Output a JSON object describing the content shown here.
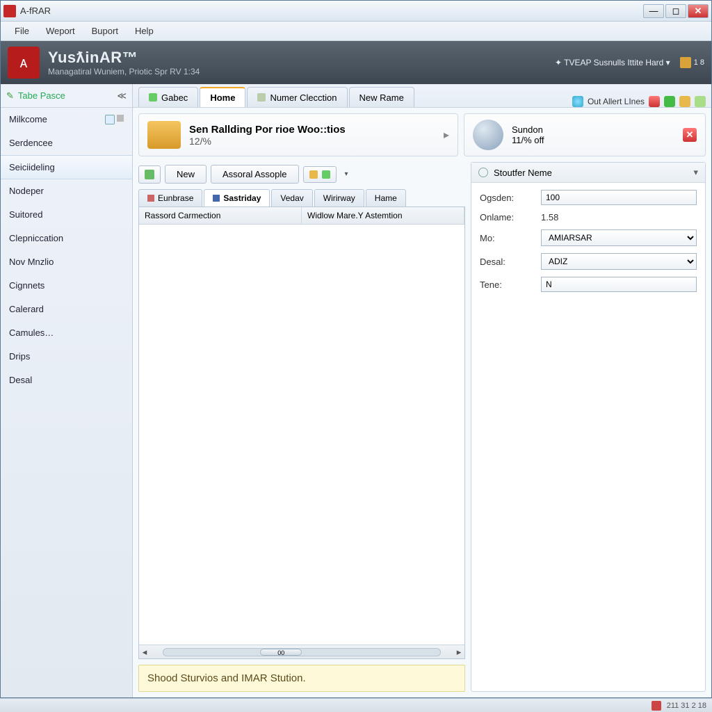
{
  "window": {
    "title": "A-fRAR"
  },
  "menubar": [
    "File",
    "Weport",
    "Buport",
    "Help"
  ],
  "brand": {
    "name": "YusƛinAR™",
    "subtitle": "Managatiral Wuniem, Priotic Spr RV 1:34",
    "right_status": "✦ TVEAP Susnulls Ittite Hard ▾",
    "right_badge": "1 8"
  },
  "sidebar": {
    "header": "Tabe Pasce",
    "items": [
      "Milkcome",
      "Serdencee",
      "Seiciideling",
      "Nodeper",
      "Suitored",
      "Clepniccation",
      "Nov Mnzlio",
      "Cignnets",
      "Calerard",
      "Camules…",
      "Drips",
      "Desal"
    ],
    "selected_index": 2
  },
  "maintabs": {
    "items": [
      "Gabec",
      "Home",
      "Numer Clecction",
      "New Rame"
    ],
    "active_index": 1
  },
  "topright": {
    "label": "Out Allert LInes"
  },
  "banner1": {
    "title": "Sen Rallding Por rioe Woo::tios",
    "sub": "12/%"
  },
  "banner2": {
    "title": "Sundon",
    "sub": "11/% off"
  },
  "toolbar": {
    "new": "New",
    "assoral": "Assoral Assople"
  },
  "subtabs": {
    "items": [
      "Eunbrase",
      "Sastriday",
      "Vedav",
      "Wirirway",
      "Hame"
    ],
    "active_index": 1
  },
  "grid": {
    "columns": [
      "Rassord Carmection",
      "Widlow Mare.Y Astemtion"
    ],
    "scroll_label": "00"
  },
  "notice": "Shood Sturvios and IMAR Stution.",
  "panel": {
    "header": "Stoutfer Neme",
    "fields": {
      "ogsden_label": "Ogsden:",
      "ogsden_value": "100",
      "onlame_label": "Onlame:",
      "onlame_value": "1.58",
      "mo_label": "Mo:",
      "mo_value": "AMIARSAR",
      "desal_label": "Desal:",
      "desal_value": "ADIZ",
      "tene_label": "Tene:",
      "tene_value": "N"
    }
  },
  "statusbar": {
    "text": "211 31 2 18"
  }
}
